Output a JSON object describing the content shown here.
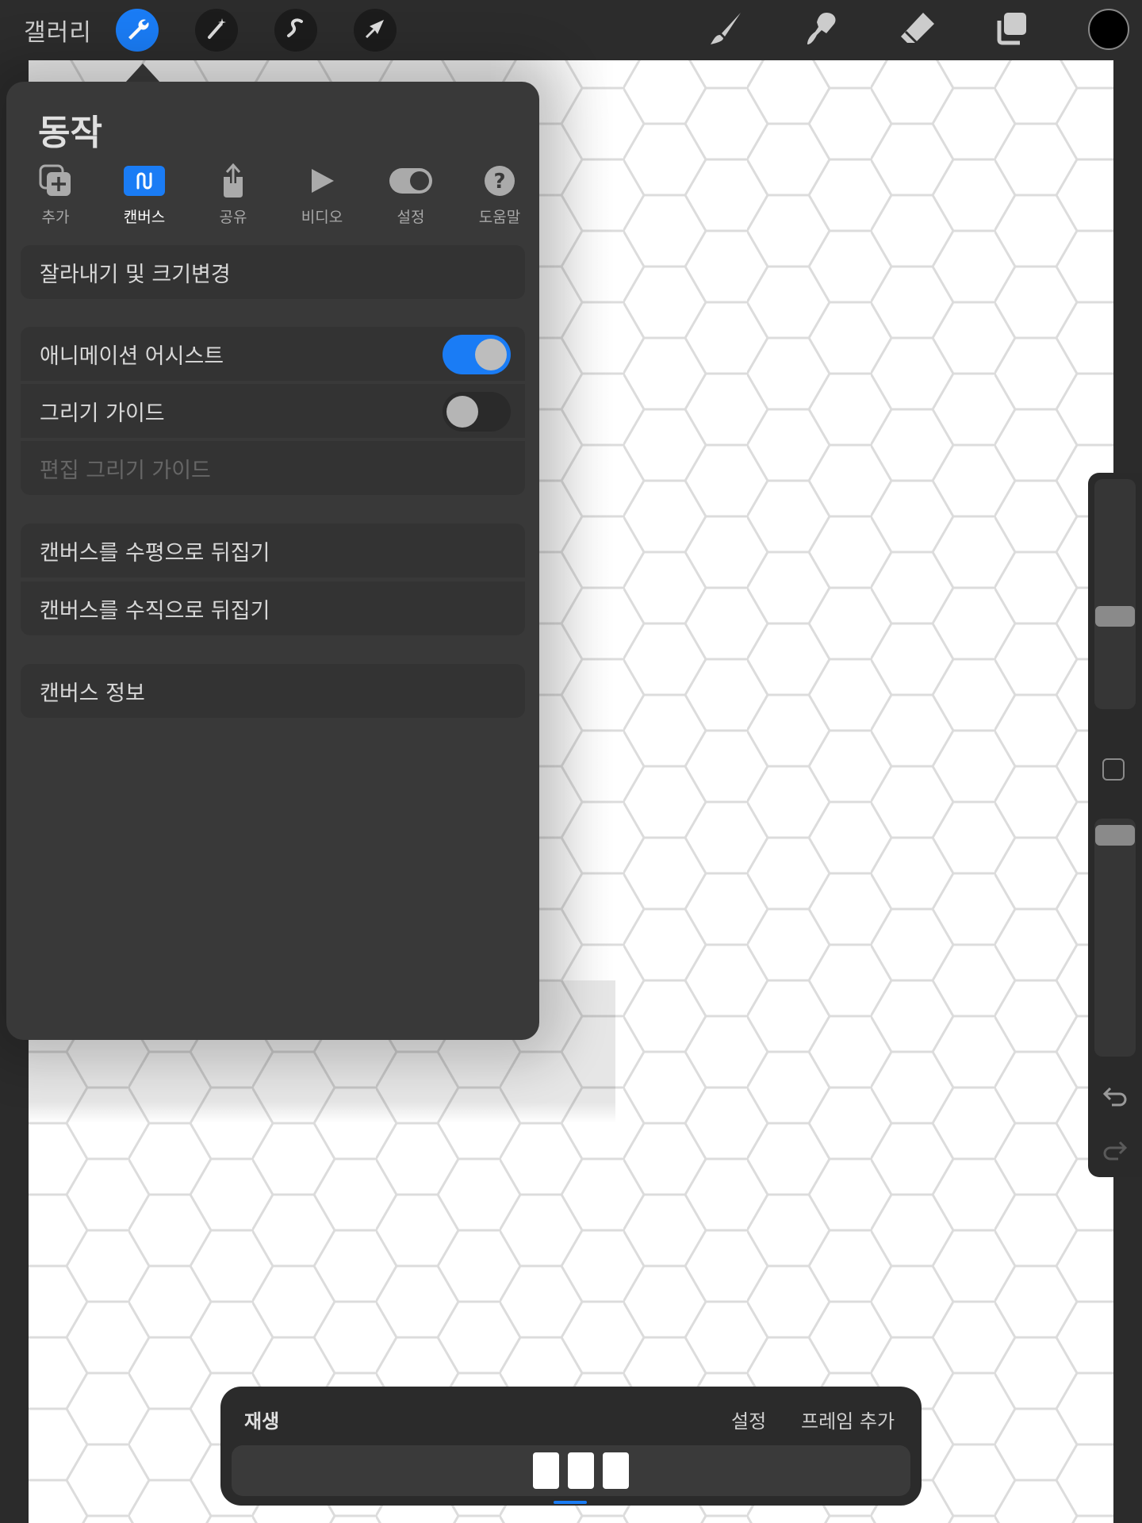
{
  "topbar": {
    "gallery_label": "갤러리",
    "tools_left": [
      "wrench-icon",
      "magic-wand-icon",
      "selection-icon",
      "transform-arrow-icon"
    ],
    "tools_right": [
      "brush-icon",
      "smudge-icon",
      "eraser-icon",
      "layers-icon"
    ],
    "color": "#000000",
    "accent": "#1a7cf5"
  },
  "actions": {
    "title": "동작",
    "tabs": [
      {
        "label": "추가",
        "icon": "add-icon"
      },
      {
        "label": "캔버스",
        "icon": "canvas-icon",
        "active": true
      },
      {
        "label": "공유",
        "icon": "share-icon"
      },
      {
        "label": "비디오",
        "icon": "play-icon"
      },
      {
        "label": "설정",
        "icon": "toggle-icon"
      },
      {
        "label": "도움말",
        "icon": "help-icon"
      }
    ],
    "crop_resize": "잘라내기 및 크기변경",
    "animation_assist": {
      "label": "애니메이션 어시스트",
      "on": true
    },
    "drawing_guide": {
      "label": "그리기 가이드",
      "on": false
    },
    "edit_drawing_guide": "편집 그리기 가이드",
    "flip_horizontal": "캔버스를 수평으로 뒤집기",
    "flip_vertical": "캔버스를 수직으로 뒤집기",
    "canvas_info": "캔버스 정보"
  },
  "animation": {
    "play": "재생",
    "settings": "설정",
    "add_frame": "프레임 추가",
    "frame_count": 3
  }
}
